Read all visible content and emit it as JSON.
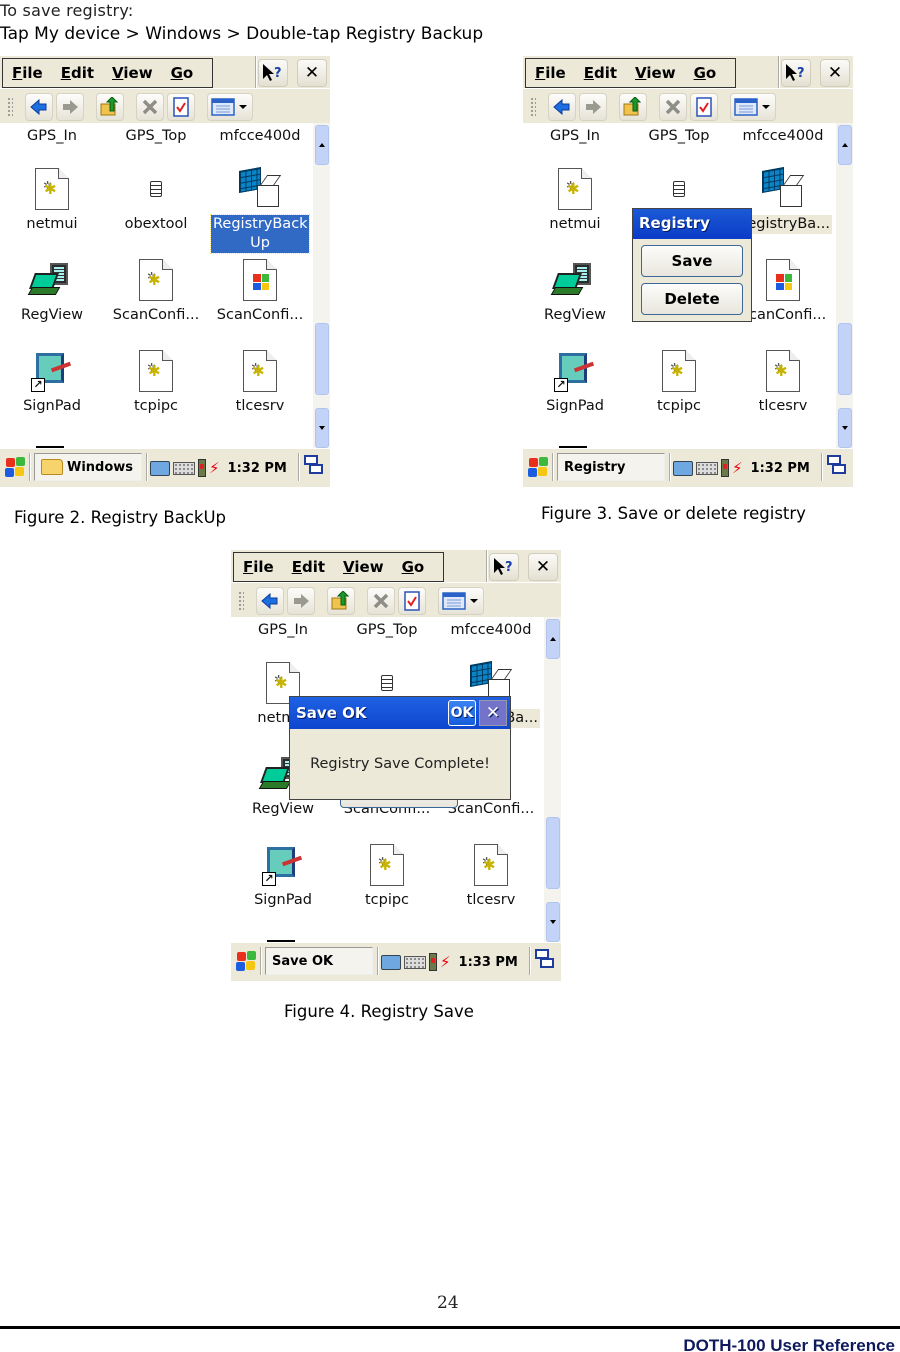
{
  "intro": {
    "line1": "To save registry:",
    "line2": "Tap My device > Windows > Double-tap Registry Backup"
  },
  "screen_common": {
    "menus": [
      {
        "key": "F",
        "rest": "ile"
      },
      {
        "key": "E",
        "rest": "dit"
      },
      {
        "key": "V",
        "rest": "iew"
      },
      {
        "key": "G",
        "rest": "o"
      }
    ],
    "help_icon": "help-pointer-icon",
    "close_label": "✕",
    "toolbar_icons": [
      "back-icon",
      "forward-icon",
      "up-folder-icon",
      "delete-icon",
      "properties-icon",
      "view-menu-icon"
    ],
    "top_row": [
      "GPS_In",
      "GPS_Top",
      "mfcce400d"
    ],
    "row2": [
      "netmui",
      "obextool",
      "RegistryBackUp"
    ],
    "row3": [
      "RegView",
      "ScanConfi...",
      "ScanConfi..."
    ],
    "row4": [
      "SignPad",
      "tcpipc",
      "tlcesrv"
    ]
  },
  "figures": [
    {
      "caption": "Figure 2. Registry BackUp",
      "selected_label": "RegistryBack Up",
      "taskbar_button": "Windows",
      "clock": "1:32 PM"
    },
    {
      "caption": "Figure 3. Save or delete registry",
      "selected_label": "egistryBa...",
      "taskbar_button": "Registry",
      "clock": "1:32 PM",
      "dialog": {
        "title": "Registry",
        "buttons": [
          "Save",
          "Delete"
        ]
      }
    },
    {
      "caption": "Figure 4. Registry Save",
      "selected_label": "Ba...",
      "taskbar_button": "Save OK",
      "clock": "1:33 PM",
      "dialog": {
        "title": "Save OK",
        "ok_label": "OK",
        "close_label": "✕",
        "message": "Registry Save Complete!"
      }
    }
  ],
  "footer": {
    "page_number": "24",
    "doc_title": "DOTH-100 User Reference"
  },
  "colors": {
    "selection": "#316ac5",
    "titlebar": "#0a3cc7",
    "chrome": "#ece9d8",
    "footer_text": "#0e1a5c"
  }
}
